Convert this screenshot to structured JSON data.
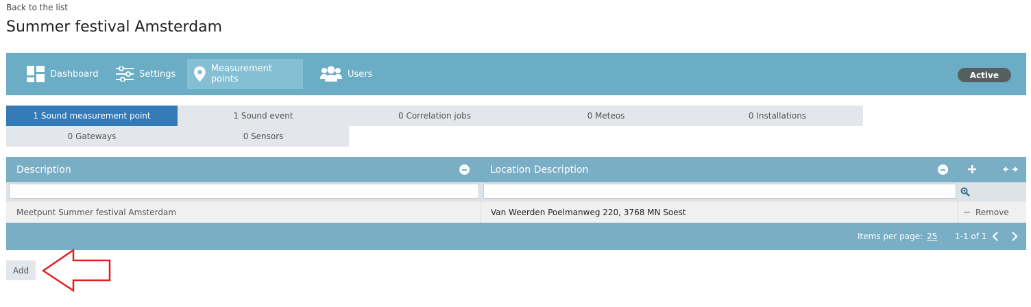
{
  "back_link": "Back to the list",
  "page_title": "Summer festival Amsterdam",
  "nav": {
    "items": [
      {
        "label": "Dashboard",
        "icon": "dashboard-icon"
      },
      {
        "label": "Settings",
        "icon": "sliders-icon"
      },
      {
        "label": "Measurement points",
        "icon": "map-pin-icon",
        "active": true
      },
      {
        "label": "Users",
        "icon": "users-icon"
      }
    ],
    "status": "Active"
  },
  "tabs": [
    {
      "label": "1 Sound measurement point",
      "active": true
    },
    {
      "label": "1 Sound event"
    },
    {
      "label": "0 Correlation jobs"
    },
    {
      "label": "0 Meteos"
    },
    {
      "label": "0 Installations"
    },
    {
      "label": "0 Gateways"
    },
    {
      "label": "0 Sensors"
    }
  ],
  "grid": {
    "columns": [
      "Description",
      "Location Description"
    ],
    "filters": [
      "",
      ""
    ],
    "rows": [
      {
        "description": "Meetpunt Summer festival Amsterdam",
        "location": "Van Weerden Poelmanweg 220, 3768 MN Soest",
        "action": "Remove"
      }
    ],
    "footer": {
      "items_per_page_label": "Items per page:",
      "items_per_page_value": "25",
      "range": "1-1 of 1"
    }
  },
  "add_button": "Add",
  "colors": {
    "navbar": "#6aadc5",
    "active_tab": "#347ab7",
    "grid_header": "#7aaec5",
    "status_pill": "#555f5f",
    "annotation": "#e02020"
  }
}
